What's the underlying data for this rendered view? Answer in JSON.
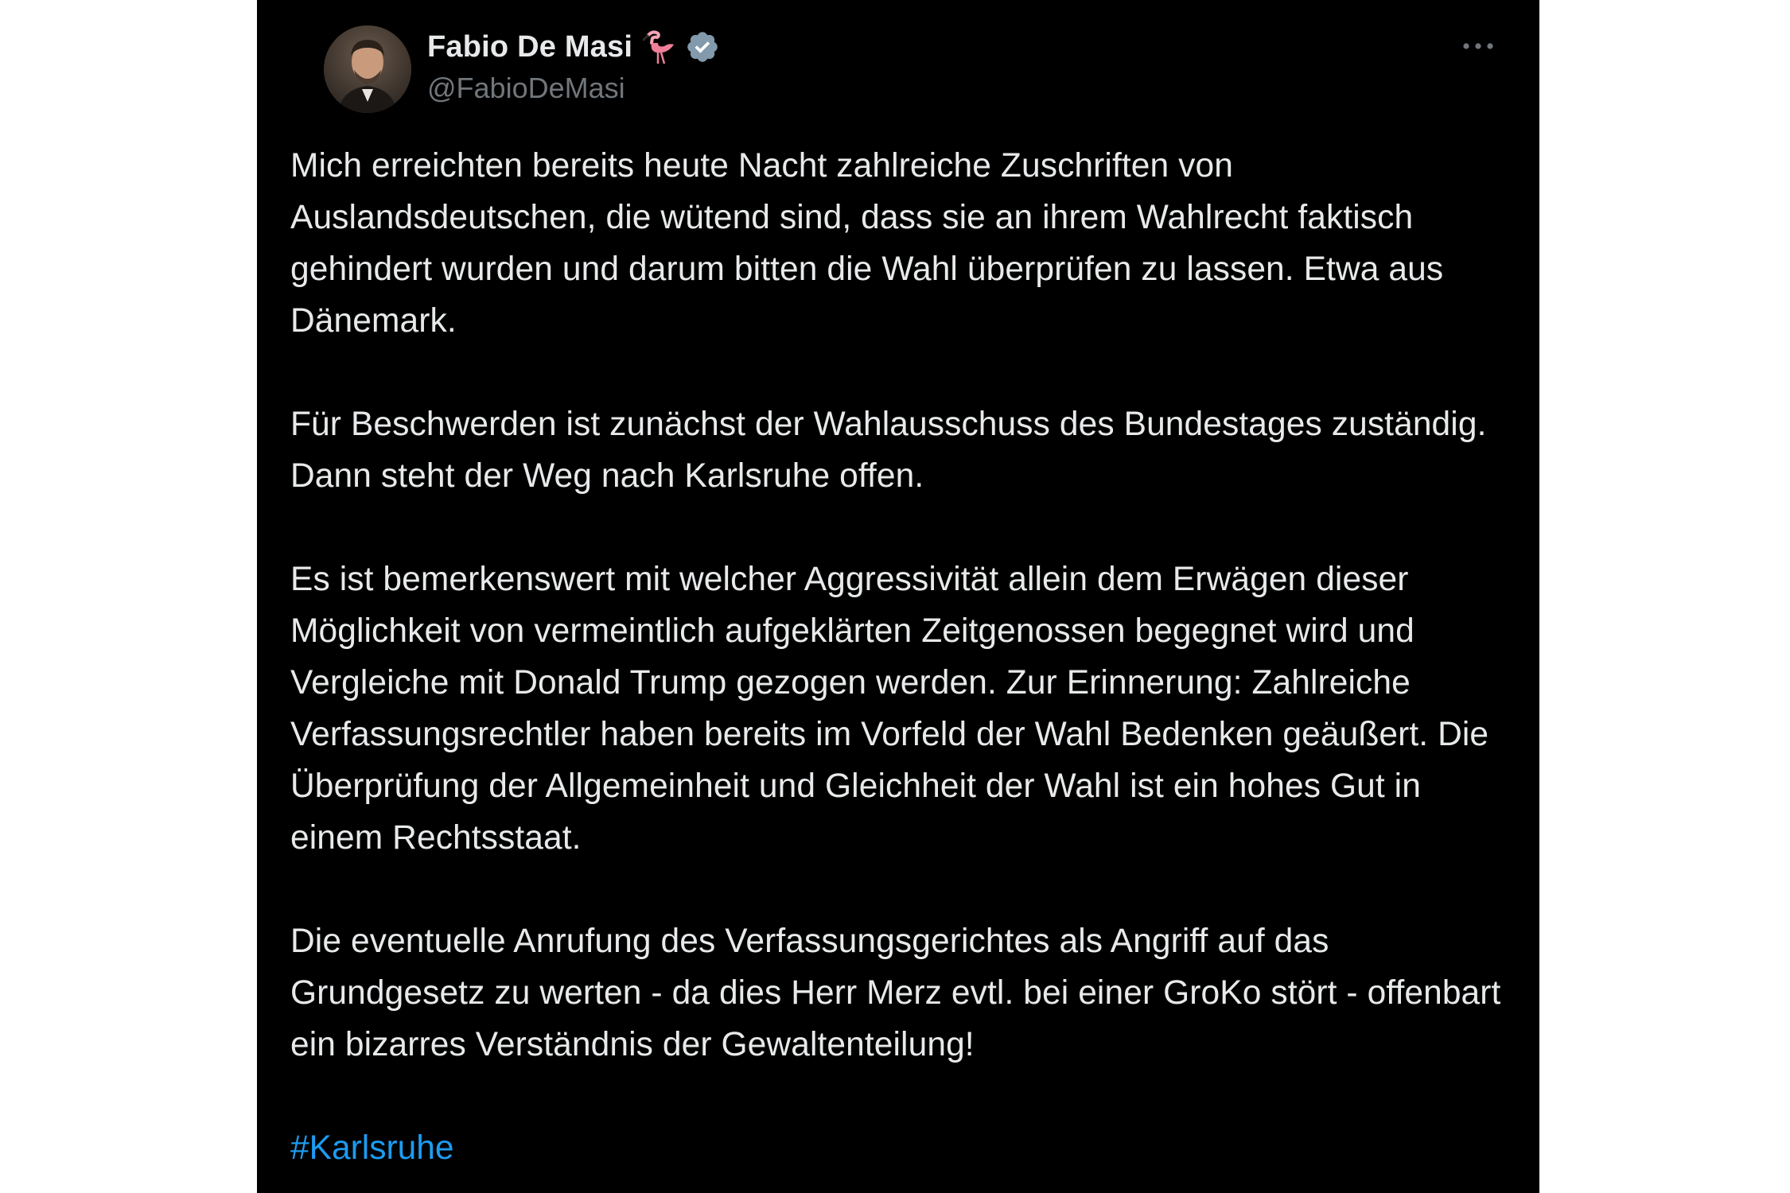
{
  "tweet": {
    "author": {
      "display_name": "Fabio De Masi",
      "handle": "@FabioDeMasi",
      "name_emoji_icon": "flamingo-emoji-icon",
      "verified_icon": "verified-badge-icon",
      "avatar_icon": "user-avatar"
    },
    "more_icon": "more-options-icon",
    "paragraphs": [
      "Mich erreichten bereits heute Nacht zahlreiche Zuschriften von Auslandsdeutschen, die wütend sind, dass sie an ihrem Wahlrecht faktisch gehindert wurden und darum bitten die Wahl überprüfen zu lassen. Etwa aus Dänemark.",
      "Für Beschwerden ist zunächst der Wahlausschuss des Bundestages zuständig. Dann steht der Weg nach Karlsruhe offen.",
      "Es ist bemerkenswert mit welcher Aggressivität allein dem Erwägen dieser Möglichkeit von vermeintlich aufgeklärten Zeitgenossen begegnet wird und Vergleiche mit Donald Trump gezogen werden. Zur Erinnerung: Zahlreiche Verfassungsrechtler haben bereits im Vorfeld der Wahl Bedenken geäußert. Die Überprüfung der Allgemeinheit und Gleichheit der Wahl ist ein hohes Gut in einem Rechtsstaat.",
      "Die eventuelle Anrufung des Verfassungsgerichtes als Angriff auf das Grundgesetz zu werten - da dies Herr Merz evtl. bei einer GroKo stört - offenbart ein bizarres Verständnis der Gewaltenteilung!"
    ],
    "hashtag": "#Karlsruhe"
  },
  "colors": {
    "card_background": "#000000",
    "page_background": "#ffffff",
    "text_primary": "#e7e9ea",
    "text_secondary": "#71767b",
    "link": "#1d9bf0",
    "verified": "#829aab"
  }
}
